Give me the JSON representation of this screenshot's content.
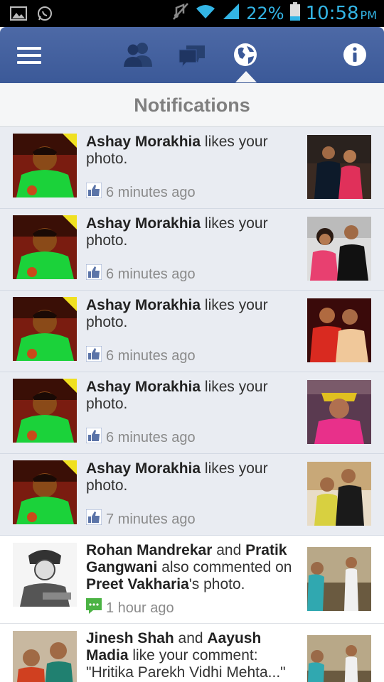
{
  "status_bar": {
    "battery_percent": "22%",
    "time": "10:58",
    "ampm": "PM",
    "icons": [
      "gallery-icon",
      "whatsapp-icon",
      "mute-icon",
      "wifi-icon",
      "signal-icon",
      "battery-icon"
    ]
  },
  "top_bar": {
    "icons": [
      "menu-icon",
      "friend-requests-icon",
      "messages-icon",
      "notifications-globe-icon",
      "info-icon"
    ],
    "active": "notifications-globe-icon",
    "color": "#3b5998"
  },
  "header": {
    "title": "Notifications"
  },
  "notifications": [
    {
      "actor": "Ashay Morakhia",
      "action": " likes your photo.",
      "time": "6 minutes ago",
      "icon": "like-icon",
      "unread": true
    },
    {
      "actor": "Ashay Morakhia",
      "action": " likes your photo.",
      "time": "6 minutes ago",
      "icon": "like-icon",
      "unread": true
    },
    {
      "actor": "Ashay Morakhia",
      "action": " likes your photo.",
      "time": "6 minutes ago",
      "icon": "like-icon",
      "unread": true
    },
    {
      "actor": "Ashay Morakhia",
      "action": " likes your photo.",
      "time": "6 minutes ago",
      "icon": "like-icon",
      "unread": true
    },
    {
      "actor": "Ashay Morakhia",
      "action": " likes your photo.",
      "time": "7 minutes ago",
      "icon": "like-icon",
      "unread": true
    },
    {
      "actor": "Rohan Mandrekar",
      "mid1": " and ",
      "actor2": "Pratik Gangwani",
      "mid2": " also commented on ",
      "actor3": "Preet Vakharia",
      "action": "'s photo.",
      "time": "1 hour ago",
      "icon": "comment-icon",
      "unread": false
    },
    {
      "actor": "Jinesh Shah",
      "mid1": " and ",
      "actor2": "Aayush Madia",
      "action": " like your comment: \"Hritika Parekh  Vidhi Mehta...\"",
      "time": "",
      "icon": "like-icon",
      "unread": false
    }
  ]
}
